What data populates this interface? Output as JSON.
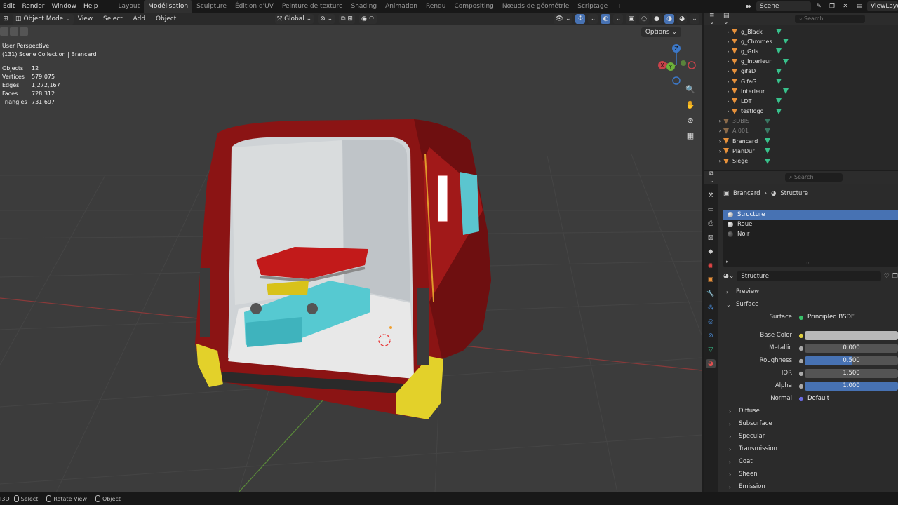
{
  "topbar": {
    "menu": [
      "Edit",
      "Render",
      "Window",
      "Help"
    ],
    "workspaces": [
      "Layout",
      "Modélisation",
      "Sculpture",
      "Édition d'UV",
      "Peinture de texture",
      "Shading",
      "Animation",
      "Rendu",
      "Compositing",
      "Nœuds de géométrie",
      "Scriptage"
    ],
    "active_workspace": "Modélisation",
    "add_tab": "+",
    "scene": "Scene",
    "view_layer": "ViewLayer"
  },
  "viewport_header": {
    "mode": "Object Mode",
    "menu": [
      "View",
      "Select",
      "Add",
      "Object"
    ],
    "orientation": "Global",
    "options": "Options"
  },
  "overlay": {
    "perspective": "User Perspective",
    "collection": "(131) Scene Collection | Brancard",
    "stats": [
      {
        "k": "Objects",
        "v": "12"
      },
      {
        "k": "Vertices",
        "v": "579,075"
      },
      {
        "k": "Edges",
        "v": "1,272,167"
      },
      {
        "k": "Faces",
        "v": "728,312"
      },
      {
        "k": "Triangles",
        "v": "731,697"
      }
    ]
  },
  "gizmo": {
    "z": "Z",
    "y": "Y",
    "x": "X"
  },
  "outliner": {
    "search_placeholder": "Search",
    "rows": [
      {
        "name": "g_Black",
        "dim": false
      },
      {
        "name": "g_Chromes",
        "dim": false
      },
      {
        "name": "g_Gris",
        "dim": false
      },
      {
        "name": "g_Interieur",
        "dim": false
      },
      {
        "name": "gifaD",
        "dim": false
      },
      {
        "name": "GifaG",
        "dim": false
      },
      {
        "name": "Interieur",
        "dim": false
      },
      {
        "name": "LDT",
        "dim": false
      },
      {
        "name": "testlogo",
        "dim": false
      },
      {
        "name": "3DBIS",
        "dim": true
      },
      {
        "name": "A.001",
        "dim": true
      },
      {
        "name": "Brancard",
        "dim": false
      },
      {
        "name": "PlanDur",
        "dim": false
      },
      {
        "name": "Siege",
        "dim": false
      }
    ]
  },
  "properties": {
    "search_placeholder": "Search",
    "breadcrumb_object": "Brancard",
    "breadcrumb_material": "Structure",
    "slots": [
      "Structure",
      "Roue",
      "Noir"
    ],
    "material_name": "Structure",
    "panels": {
      "preview": "Preview",
      "surface": "Surface"
    },
    "surface_rows": {
      "surface_label": "Surface",
      "surface_value": "Principled BSDF",
      "base_color_label": "Base Color",
      "metallic_label": "Metallic",
      "metallic_value": "0.000",
      "roughness_label": "Roughness",
      "roughness_value": "0.500",
      "ior_label": "IOR",
      "ior_value": "1.500",
      "alpha_label": "Alpha",
      "alpha_value": "1.000",
      "normal_label": "Normal",
      "normal_value": "Default"
    },
    "roughness_fraction": 0.5,
    "alpha_fraction": 1.0,
    "base_color": "#b8b8b8",
    "subpanels": [
      "Diffuse",
      "Subsurface",
      "Specular",
      "Transmission",
      "Coat",
      "Sheen",
      "Emission"
    ]
  },
  "statusbar": {
    "select": "Select",
    "rotate": "Rotate View",
    "object": "Object"
  },
  "colors": {
    "accent": "#4772b3",
    "object_icon": "#e8913a",
    "mesh_icon": "#38c28c"
  }
}
